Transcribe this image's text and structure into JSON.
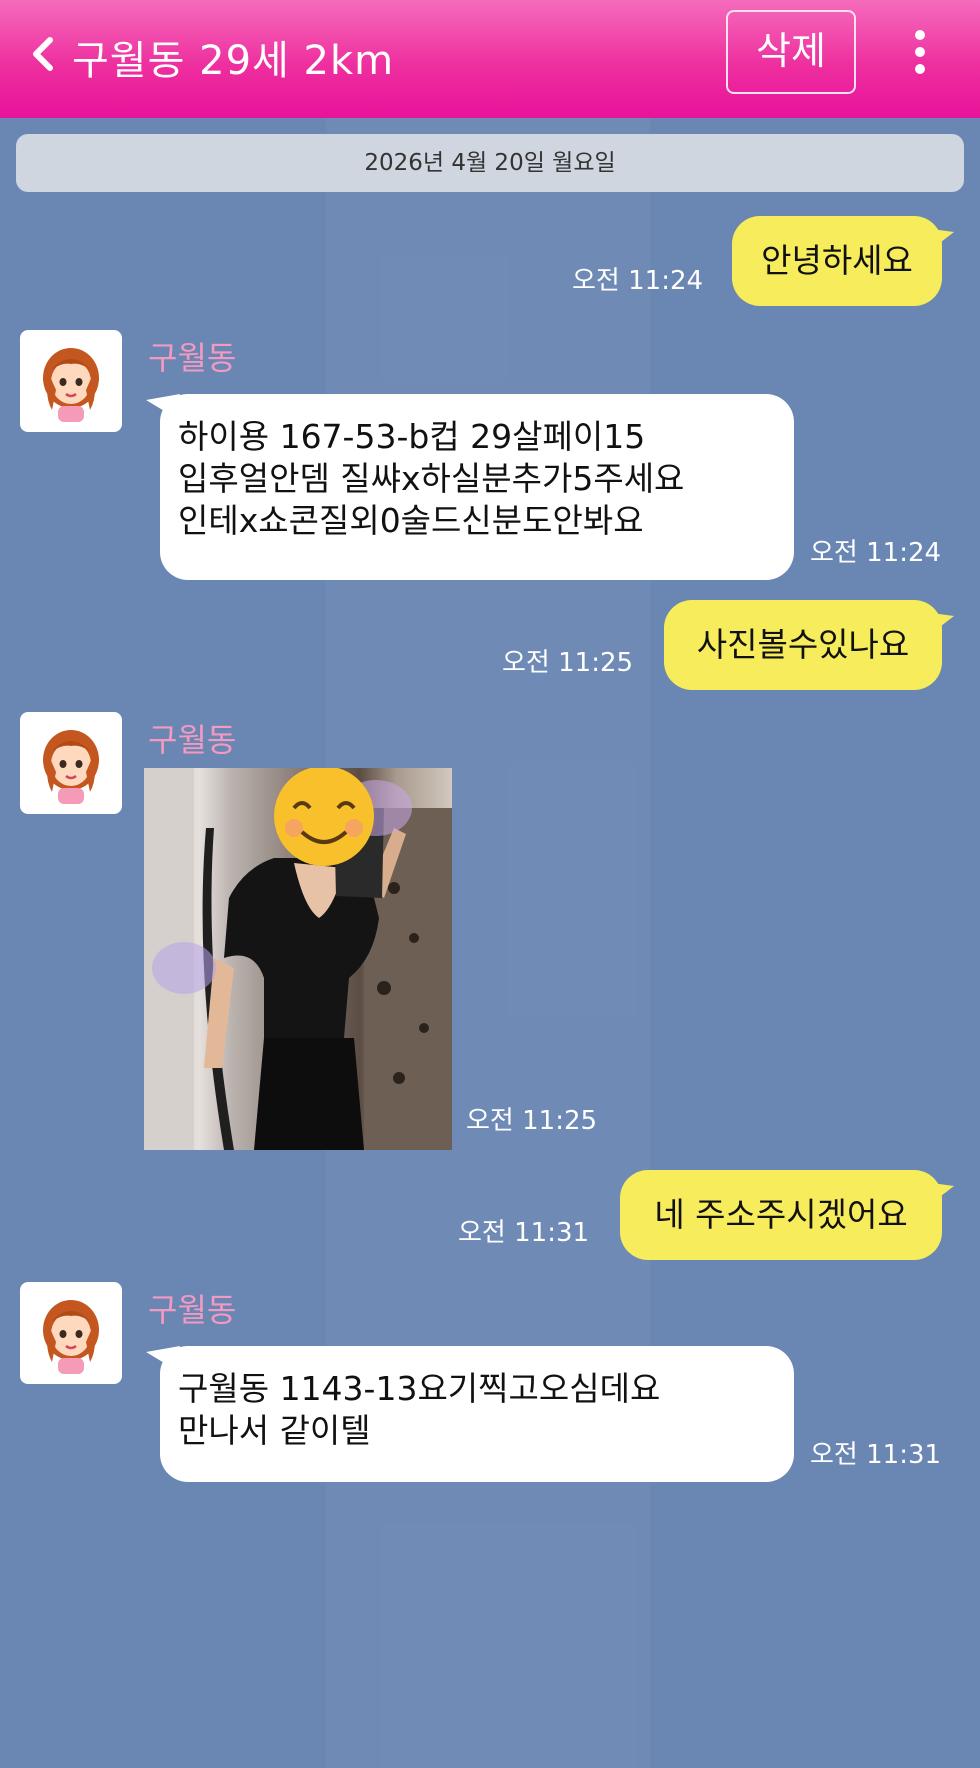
{
  "header": {
    "title": "구월동 29세 2km",
    "delete_label": "삭제"
  },
  "date_divider": "2026년 4월 20일 월요일",
  "messages": [
    {
      "side": "mine",
      "text": "안녕하세요",
      "time": "오전 11:24"
    },
    {
      "side": "theirs",
      "sender": "구월동",
      "lines": [
        "하이용 167-53-b컵 29살페이15",
        "입후얼안뎀 질쌰x하실분추가5주세요",
        "인테x쇼콘질외0술드신분도안봐요"
      ],
      "time": "오전 11:24"
    },
    {
      "side": "mine",
      "text": "사진볼수있나요",
      "time": "오전 11:25"
    },
    {
      "side": "theirs",
      "sender": "구월동",
      "type": "photo",
      "time": "오전 11:25"
    },
    {
      "side": "mine",
      "text": "네 주소주시겠어요",
      "time": "오전 11:31"
    },
    {
      "side": "theirs",
      "sender": "구월동",
      "lines": [
        "구월동 1143-13요기찍고오심데요",
        "만나서 같이텔"
      ],
      "time": "오전 11:31"
    }
  ],
  "colors": {
    "header": "#ee2f9f",
    "background": "#6a87b3",
    "my_bubble": "#f7ec5b",
    "their_bubble": "#ffffff",
    "sender_name": "#f29ac0"
  },
  "icons": {
    "back": "chevron-left-icon",
    "more": "more-vertical-icon",
    "avatar": "cartoon-girl-avatar",
    "photo_sticker": "smiling-face-emoji"
  }
}
